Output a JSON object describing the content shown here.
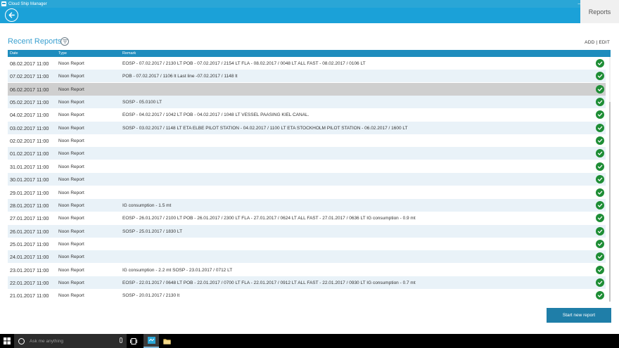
{
  "window": {
    "title": "Cloud Ship Manager",
    "controls": [
      "—",
      "▫",
      "✕"
    ]
  },
  "header": {
    "back_icon": "back-arrow-icon",
    "active_tab": "Reports"
  },
  "page": {
    "title": "Recent Reports",
    "filter_icon": "filter-icon",
    "add_edit_label": "ADD | EDIT"
  },
  "table": {
    "columns": [
      "Date",
      "Type",
      "Remark"
    ],
    "rows": [
      {
        "date": "08.02.2017 11:00",
        "type": "Noon Report",
        "remark": "EOSP - 07.02.2017 / 2130 LT POB - 07.02.2017 / 2154 LT FLA - 08.02.2017 / 0048 LT ALL FAST - 08.02.2017 / 0106 LT",
        "status": "ok"
      },
      {
        "date": "07.02.2017 11:00",
        "type": "Noon Report",
        "remark": "POB - 07.02.2017 / 1106 lt Last line -07.02.2017 / 1148 lt",
        "status": "ok"
      },
      {
        "date": "06.02.2017 11:00",
        "type": "Noon Report",
        "remark": "",
        "status": "ok"
      },
      {
        "date": "05.02.2017 11:00",
        "type": "Noon Report",
        "remark": "SOSP - 05.0100 LT",
        "status": "ok"
      },
      {
        "date": "04.02.2017 11:00",
        "type": "Noon Report",
        "remark": "EOSP - 04.02.2017 / 1042 LT POB - 04.02.2017 / 1048 LT VESSEL PAASING KIEL CANAL.",
        "status": "ok"
      },
      {
        "date": "03.02.2017 11:00",
        "type": "Noon Report",
        "remark": "SOSP - 03.02.2017 / 1148 LT ETA ELBE PILOT STATION - 04.02.2017 / 1100 LT ETA STOCKHOLM PILOT STATION - 06.02.2017 / 1600 LT",
        "status": "ok"
      },
      {
        "date": "02.02.2017 11:00",
        "type": "Noon Report",
        "remark": "",
        "status": "ok"
      },
      {
        "date": "01.02.2017 11:00",
        "type": "Noon Report",
        "remark": "",
        "status": "ok"
      },
      {
        "date": "31.01.2017 11:00",
        "type": "Noon Report",
        "remark": "",
        "status": "ok"
      },
      {
        "date": "30.01.2017 11:00",
        "type": "Noon Report",
        "remark": "",
        "status": "ok"
      },
      {
        "date": "29.01.2017 11:00",
        "type": "Noon Report",
        "remark": "",
        "status": "ok"
      },
      {
        "date": "28.01.2017 11:00",
        "type": "Noon Report",
        "remark": "IG consumption - 1.5 mt",
        "status": "ok"
      },
      {
        "date": "27.01.2017 11:00",
        "type": "Noon Report",
        "remark": "EOSP - 26.01.2017 / 2100 LT POB - 26.01.2017 / 2300 LT FLA - 27.01.2017 / 0624 LT ALL FAST - 27.01.2017 / 0636 LT IG consumption - 0.9 mt",
        "status": "ok"
      },
      {
        "date": "26.01.2017 11:00",
        "type": "Noon Report",
        "remark": "SOSP - 25.01.2017 / 1830 LT",
        "status": "ok"
      },
      {
        "date": "25.01.2017 11:00",
        "type": "Noon Report",
        "remark": "",
        "status": "ok"
      },
      {
        "date": "24.01.2017 11:00",
        "type": "Noon Report",
        "remark": "",
        "status": "ok"
      },
      {
        "date": "23.01.2017 11:00",
        "type": "Noon Report",
        "remark": "IG consumption - 2.2 mt SOSP - 23.01.2017 / 0712 LT",
        "status": "ok"
      },
      {
        "date": "22.01.2017 11:00",
        "type": "Noon Report",
        "remark": "EOSP - 22.01.2017 / 0648 LT POB - 22.01.2017 / 0700 LT FLA - 22.01.2017 / 0912 LT ALL FAST - 22.01.2017 / 0930 LT IG consumption - 0.7 mt",
        "status": "ok"
      },
      {
        "date": "21.01.2017 11:00",
        "type": "Noon Report",
        "remark": "SOSP - 20.01.2017 / 2130 lt",
        "status": "ok"
      }
    ],
    "selected_index": 2
  },
  "actions": {
    "start_new_report": "Start new report"
  },
  "taskbar": {
    "search_placeholder": "Ask me anything",
    "icons": [
      "windows-start-icon",
      "cortana-icon",
      "microphone-icon",
      "task-view-icon",
      "cloud-ship-manager-app-icon",
      "file-explorer-icon"
    ]
  },
  "colors": {
    "header": "#1ba1d8",
    "table_header": "#1e8cbd",
    "status_ok": "#1e8d35",
    "selected_row": "#cfcfcf",
    "alt_row": "#e9f2f8"
  }
}
